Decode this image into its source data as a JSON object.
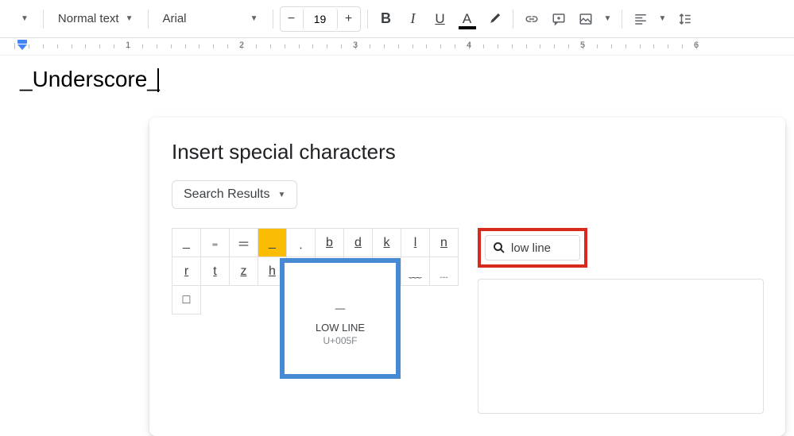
{
  "toolbar": {
    "style_label": "Normal text",
    "font_label": "Arial",
    "font_size": "19",
    "minus": "−",
    "plus": "+"
  },
  "ruler": {
    "marks": [
      1,
      2,
      3,
      4,
      5,
      6
    ]
  },
  "doc": {
    "text": "_Underscore_"
  },
  "dialog": {
    "title": "Insert special characters",
    "category": "Search Results",
    "search_value": "low line",
    "tooltip": {
      "char": "_",
      "name": "LOW LINE",
      "code": "U+005F"
    },
    "grid": [
      [
        {
          "g": "_"
        },
        {
          "g": "₌"
        },
        {
          "g": "＝"
        },
        {
          "g": "_",
          "hl": true
        },
        {
          "g": "﹒"
        },
        {
          "g": "b",
          "u": true
        },
        {
          "g": "d",
          "u": true
        },
        {
          "g": "k",
          "u": true
        },
        {
          "g": "l",
          "u": true
        },
        {
          "g": "n",
          "u": true
        }
      ],
      [
        {
          "g": "r",
          "u": true
        },
        {
          "g": "t",
          "u": true
        },
        {
          "g": "z",
          "u": true
        },
        {
          "g": "h",
          "u": true
        },
        {
          "g": " "
        },
        {
          "g": " "
        },
        {
          "g": " "
        },
        {
          "g": " "
        },
        {
          "g": "﹏"
        },
        {
          "g": "﹍"
        }
      ],
      [
        {
          "g": "□"
        }
      ]
    ]
  }
}
